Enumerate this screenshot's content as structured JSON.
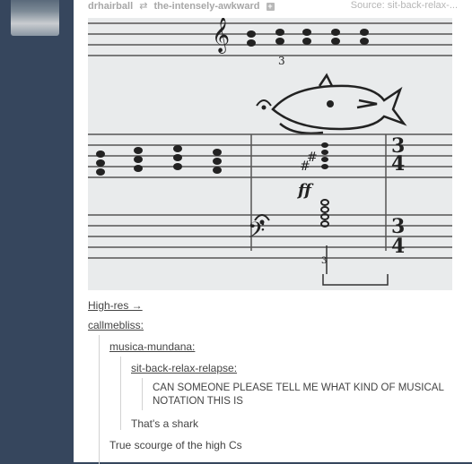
{
  "header": {
    "poster": "drhairball",
    "reblogged_from": "the-intensely-awkward",
    "source": "Source: sit-back-relax-..."
  },
  "caption": {
    "high_res": "High-res →",
    "user1": "callmebliss:",
    "user2": "musica-mundana:",
    "user3": "sit-back-relax-relapse:",
    "quote_original": "CAN SOMEONE PLEASE TELL ME WHAT KIND OF MUSICAL NOTATION THIS IS",
    "reply1": "That's a shark",
    "reply2": "True scourge of the high Cs"
  },
  "colors": {
    "background": "#36465d",
    "post": "#ffffff",
    "paper": "#eceeef"
  }
}
